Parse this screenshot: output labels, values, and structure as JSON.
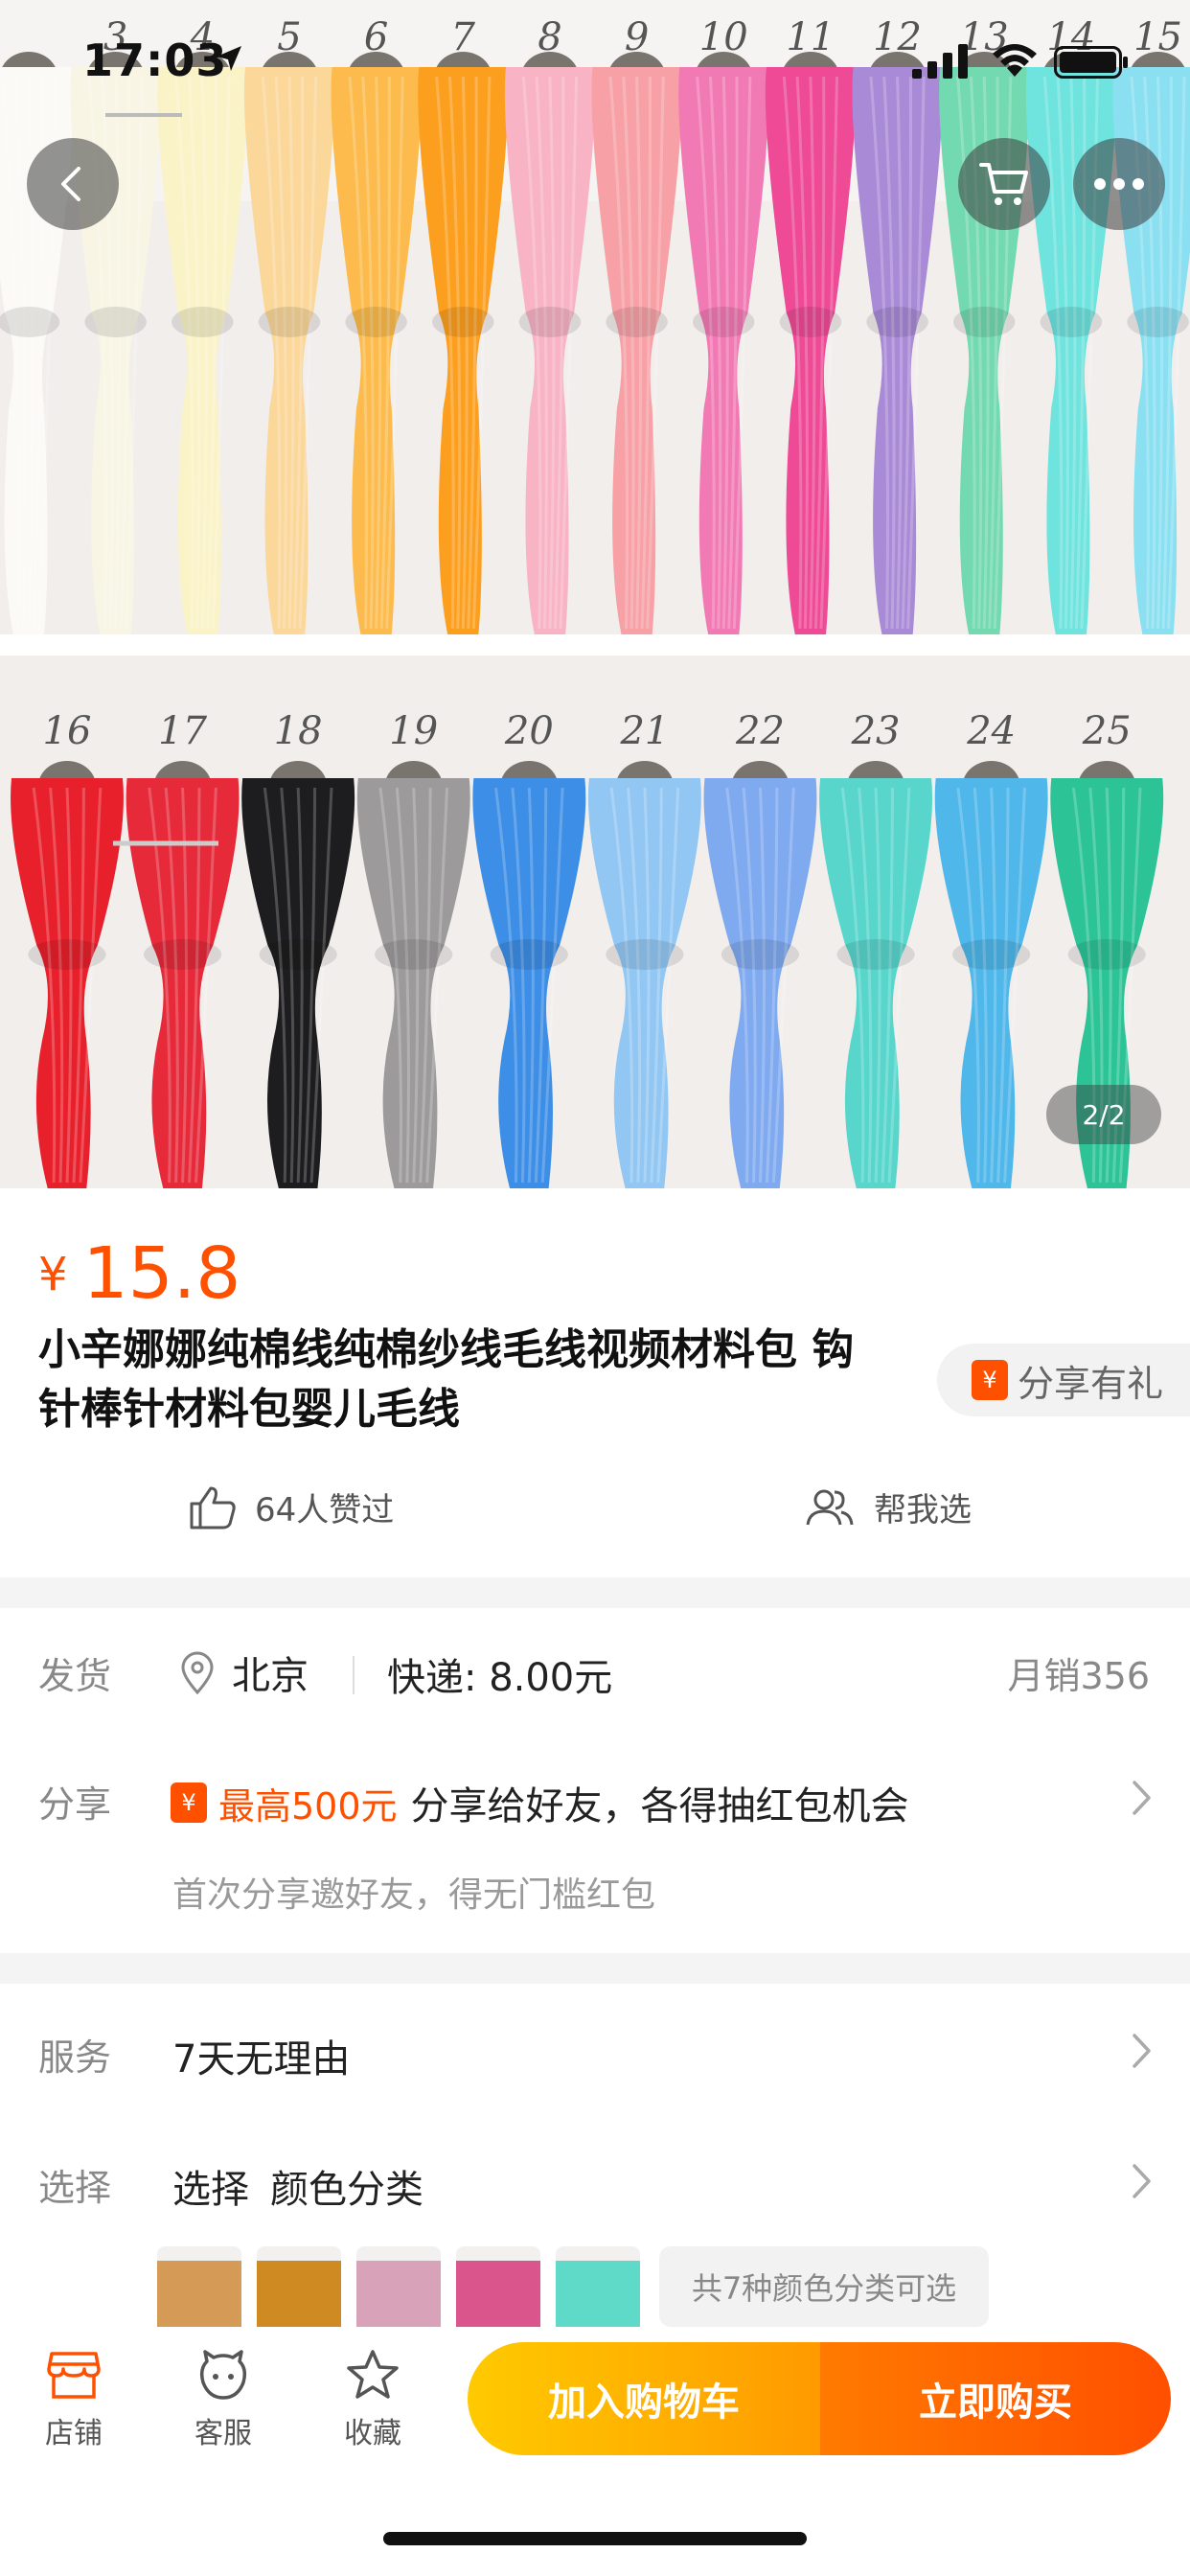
{
  "status_bar": {
    "time": "17:03"
  },
  "hero": {
    "counter": "2/2",
    "top_row_numbers": [
      "3",
      "4",
      "5",
      "6",
      "7",
      "8",
      "9",
      "10",
      "11",
      "12",
      "13",
      "14",
      "15"
    ],
    "bottom_row_numbers": [
      "16",
      "17",
      "18",
      "19",
      "20",
      "21",
      "22",
      "23",
      "24",
      "25"
    ],
    "top_colors": [
      "#fbfaf6",
      "#f8f5e4",
      "#faf3c8",
      "#fbd79a",
      "#fcbb4c",
      "#fd9f1e",
      "#f8b3c4",
      "#f7a1a6",
      "#f27ab4",
      "#ee4a96",
      "#a98ad6",
      "#73d9b0",
      "#6fe3de",
      "#8adff1"
    ],
    "bottom_colors": [
      "#e8202c",
      "#e62a3a",
      "#1d1d1f",
      "#9d9a9c",
      "#3d8ee6",
      "#92c7f3",
      "#7faaf0",
      "#58d6cc",
      "#4fb7ea",
      "#2cc497"
    ],
    "card_color": "#f1eeec"
  },
  "product": {
    "currency": "¥",
    "price": "15.8",
    "title": "小辛娜娜纯棉线纯棉纱线毛线视频材料包 钩针棒针材料包婴儿毛线",
    "share_gift_icon": "¥",
    "share_gift": "分享有礼",
    "likes": "64人赞过",
    "help_choose": "帮我选"
  },
  "shipping": {
    "label": "发货",
    "city": "北京",
    "fee": "快递: 8.00元",
    "monthly_sales": "月销356"
  },
  "share_row": {
    "label": "分享",
    "icon": "¥",
    "highlight": "最高500元",
    "text": "分享给好友，各得抽红包机会",
    "sub": "首次分享邀好友，得无门槛红包"
  },
  "service": {
    "label": "服务",
    "value": "7天无理由"
  },
  "select": {
    "label": "选择",
    "prefix": "选择",
    "value": "颜色分类",
    "swatch_colors": [
      "#d59a55",
      "#d08a22",
      "#d8a2b8",
      "#d9558c",
      "#5fd9c8"
    ],
    "more_note": "共7种颜色分类可选"
  },
  "bottom_bar": {
    "shop": "店铺",
    "service": "客服",
    "favorite": "收藏",
    "add_to_cart": "加入购物车",
    "buy_now": "立即购买"
  },
  "colors": {
    "accent": "#ff5000",
    "cart_gradient": [
      "#ffca00",
      "#ff9a00"
    ],
    "buy_gradient": [
      "#ff7a00",
      "#ff4f00"
    ]
  }
}
